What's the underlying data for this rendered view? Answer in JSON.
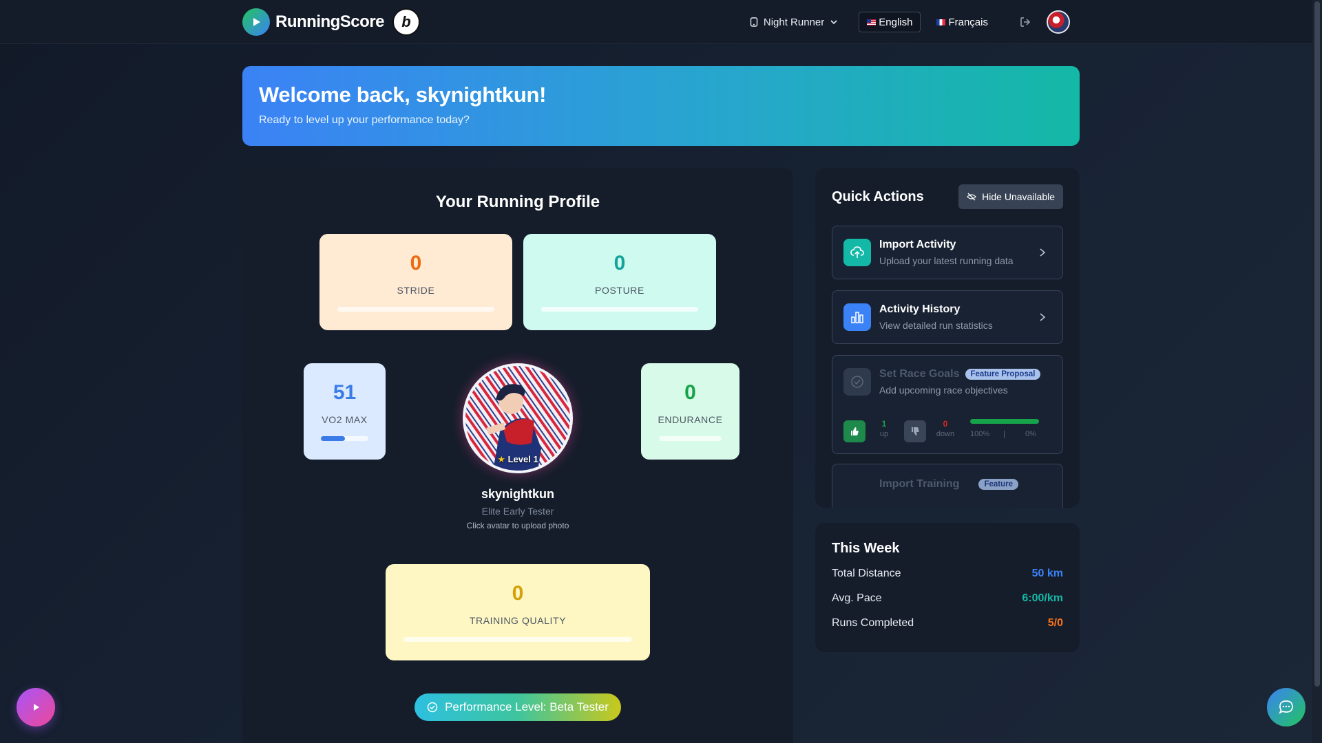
{
  "brand": {
    "name": "RunningScore",
    "badge_letter": "b"
  },
  "header": {
    "profile_switch_label": "Night Runner",
    "languages": [
      {
        "label": "English",
        "flag": "us",
        "active": true
      },
      {
        "label": "Français",
        "flag": "fr",
        "active": false
      }
    ]
  },
  "welcome": {
    "title": "Welcome back, skynightkun!",
    "subtitle": "Ready to level up your performance today?"
  },
  "profile": {
    "title": "Your Running Profile",
    "stats": {
      "stride": {
        "value": "0",
        "label": "STRIDE",
        "progress": 0
      },
      "posture": {
        "value": "0",
        "label": "POSTURE",
        "progress": 0
      },
      "vo2max": {
        "value": "51",
        "label": "VO2 MAX",
        "progress": 0.51
      },
      "endurance": {
        "value": "0",
        "label": "ENDURANCE",
        "progress": 0
      },
      "training_quality": {
        "value": "0",
        "label": "TRAINING QUALITY",
        "progress": 0
      }
    },
    "level_badge": "Level 1",
    "username": "skynightkun",
    "rank": "Elite Early Tester",
    "avatar_hint": "Click avatar to upload photo",
    "performance_level": "Performance Level: Beta Tester"
  },
  "quick_actions": {
    "title": "Quick Actions",
    "hide_button": "Hide Unavailable",
    "items": [
      {
        "title": "Import Activity",
        "desc": "Upload your latest running data",
        "icon": "cloud-upload-icon",
        "color": "#14b8a6"
      },
      {
        "title": "Activity History",
        "desc": "View detailed run statistics",
        "icon": "bar-chart-icon",
        "color": "#3b82f6"
      },
      {
        "title": "Set Race Goals",
        "badge": "Feature Proposal",
        "desc": "Add upcoming race objectives",
        "icon": "target-icon"
      },
      {
        "title": "Import Training",
        "badge": "Feature"
      }
    ],
    "votes": {
      "up_count": "1",
      "up_label": "up",
      "down_count": "0",
      "down_label": "down",
      "up_pct_label": "100%",
      "down_pct_label": "0%",
      "up_share": 1.0
    }
  },
  "this_week": {
    "title": "This Week",
    "rows": [
      {
        "label": "Total Distance",
        "value": "50 km",
        "color": "#3b82f6"
      },
      {
        "label": "Avg. Pace",
        "value": "6:00/km",
        "color": "#14b8a6"
      },
      {
        "label": "Runs Completed",
        "value": "5/0",
        "color": "#f97316"
      }
    ]
  },
  "colors": {
    "accent_blue": "#3b82f6",
    "accent_teal": "#14b8a6",
    "accent_orange": "#f97316",
    "vote_up": "#16a34a",
    "vote_down": "#dc2626"
  }
}
